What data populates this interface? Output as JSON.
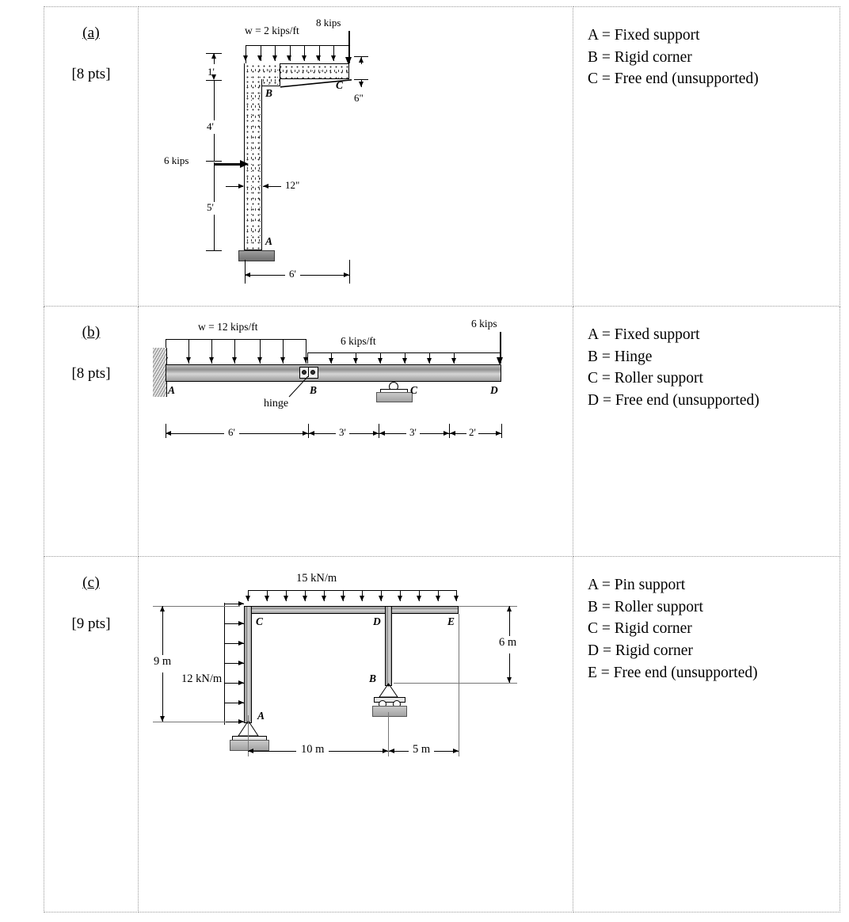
{
  "document": {
    "type": "structural-analysis-problem-set",
    "rows": [
      {
        "tag": "(a)",
        "points": "[8 pts]",
        "answers": [
          "A = Fixed support",
          "B = Rigid corner",
          "C = Free end (unsupported)"
        ],
        "figure": {
          "id": "figure-a",
          "labels": {
            "udl": "w = 2 kips/ft",
            "point_load": "8 kips",
            "lateral_load": "6 kips",
            "node_a": "A",
            "node_b": "B",
            "node_c": "C"
          },
          "dimensions": {
            "top_depth": "1'",
            "upper_height": "4'",
            "lower_height": "5'",
            "column_width": "12\"",
            "tip_depth": "6\"",
            "span": "6'"
          }
        }
      },
      {
        "tag": "(b)",
        "points": "[8 pts]",
        "answers": [
          "A = Fixed support",
          "B = Hinge",
          "C = Roller support",
          "D = Free end (unsupported)"
        ],
        "figure": {
          "id": "figure-b",
          "labels": {
            "udl_left": "w = 12 kips/ft",
            "udl_right": "6 kips/ft",
            "point_load": "6 kips",
            "node_a": "A",
            "node_b": "B",
            "node_c": "C",
            "node_d": "D",
            "hinge_note": "hinge"
          },
          "dimensions": {
            "seg1": "6'",
            "seg2": "3'",
            "seg3": "3'",
            "seg4": "2'"
          }
        }
      },
      {
        "tag": "(c)",
        "points": "[9 pts]",
        "answers": [
          "A = Pin support",
          "B = Roller support",
          "C = Rigid corner",
          "D = Rigid corner",
          "E = Free end (unsupported)"
        ],
        "figure": {
          "id": "figure-c",
          "labels": {
            "udl_top": "15 kN/m",
            "udl_side": "12 kN/m",
            "node_a": "A",
            "node_b": "B",
            "node_c": "C",
            "node_d": "D",
            "node_e": "E"
          },
          "dimensions": {
            "column_height": "9 m",
            "right_height": "6 m",
            "span_cd": "10 m",
            "span_de": "5 m"
          }
        }
      }
    ]
  },
  "colors": {
    "table_border": "#9a9a9a",
    "ink": "#000000",
    "steel_light": "#d6d6d6",
    "steel_dark": "#8f8f8f",
    "ground": "#9d9d9d"
  }
}
